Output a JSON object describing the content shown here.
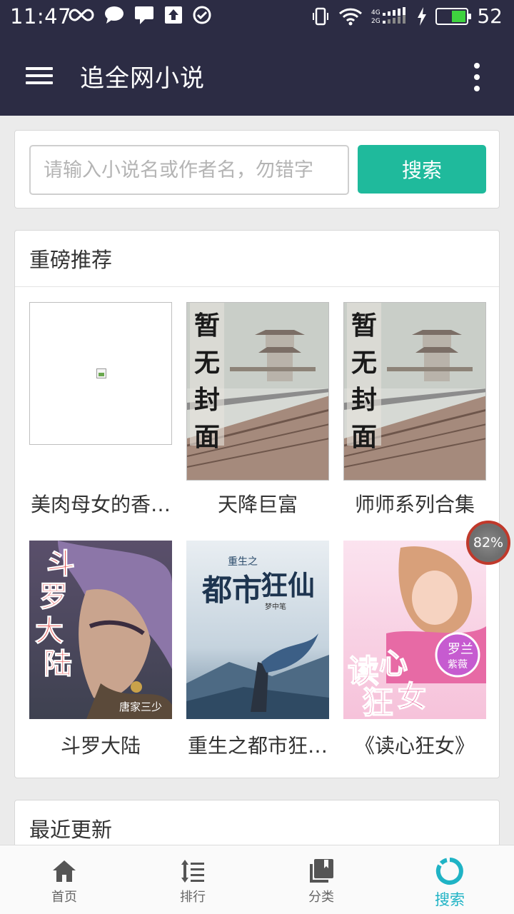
{
  "status_bar": {
    "time": "11:47",
    "battery_level": "52",
    "battery_fill_fraction": 0.52
  },
  "app_bar": {
    "title": "追全网小说",
    "menu_icon": "hamburger-menu-icon",
    "more_icon": "more-vertical-icon"
  },
  "search": {
    "placeholder": "请输入小说名或作者名，勿错字",
    "value": "",
    "button_label": "搜索"
  },
  "recommend": {
    "title": "重磅推荐",
    "books": [
      {
        "name": "美肉母女的香…",
        "cover": "broken-image"
      },
      {
        "name": "天降巨富",
        "cover": "placeholder-no-cover",
        "cover_text": "暂无封面"
      },
      {
        "name": "师师系列合集",
        "cover": "placeholder-no-cover",
        "cover_text": "暂无封面"
      },
      {
        "name": "斗罗大陆",
        "cover": "art",
        "cover_title": "斗罗大陆",
        "cover_author": "唐家三少"
      },
      {
        "name": "重生之都市狂…",
        "cover": "art",
        "cover_title": "都市狂仙",
        "cover_subtitle": "重生之",
        "cover_author": "梦中笔"
      },
      {
        "name": "《读心狂女》",
        "cover": "art",
        "cover_title": "读心狂女",
        "cover_author": "罗兰紫薇"
      }
    ]
  },
  "floating_badge": {
    "text": "82%"
  },
  "recent": {
    "title": "最近更新"
  },
  "bottom_nav": {
    "items": [
      {
        "label": "首页",
        "icon": "home-icon",
        "active": false
      },
      {
        "label": "排行",
        "icon": "ranking-icon",
        "active": false
      },
      {
        "label": "分类",
        "icon": "category-book-icon",
        "active": false
      },
      {
        "label": "搜索",
        "icon": "search-ring-icon",
        "active": true
      }
    ]
  },
  "colors": {
    "header_bg": "#2c2c44",
    "accent_teal": "#1fba9c",
    "nav_active": "#1fb3c5"
  }
}
